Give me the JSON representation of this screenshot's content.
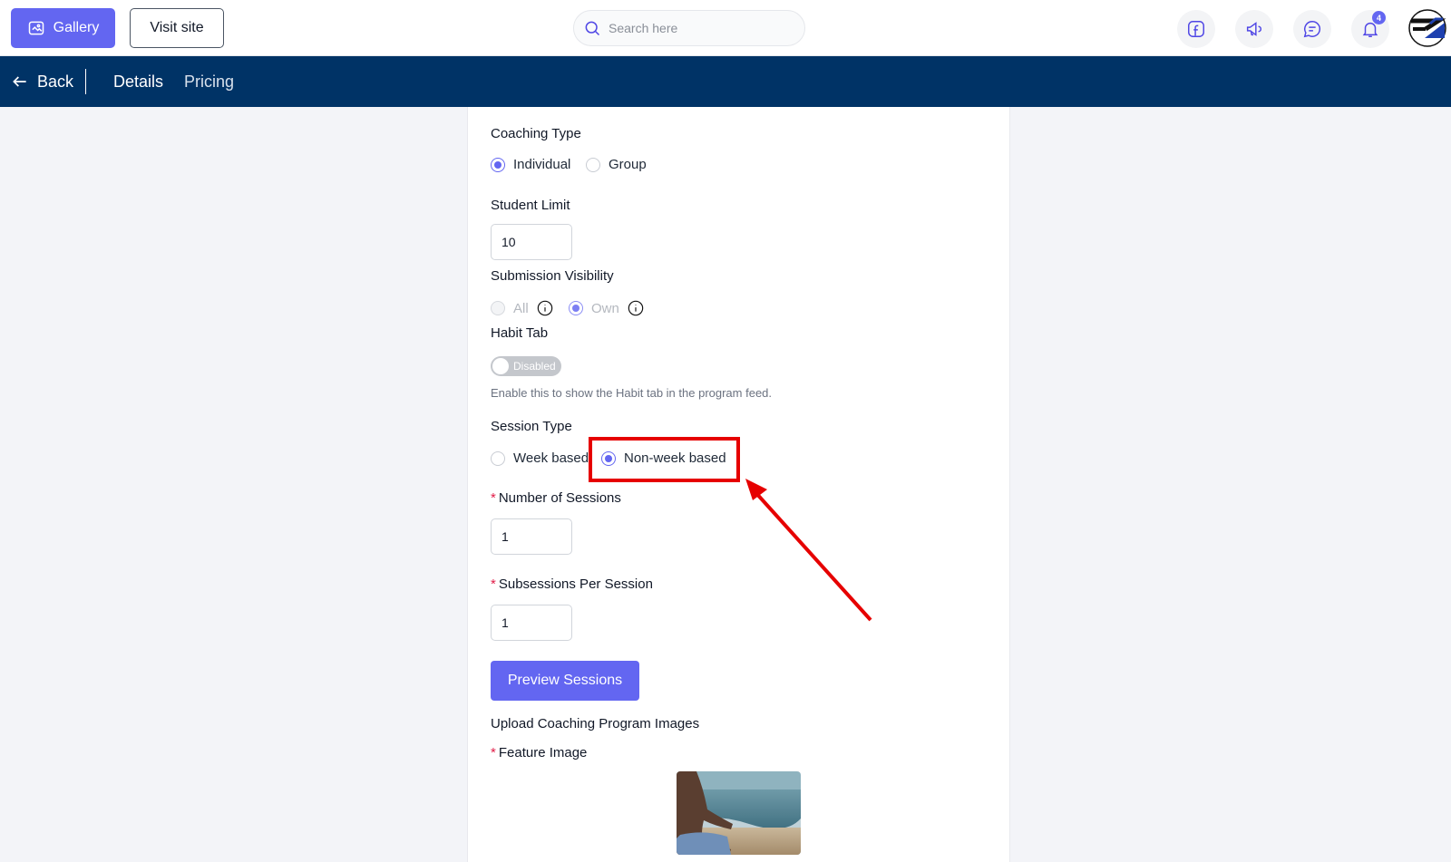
{
  "topbar": {
    "gallery_label": "Gallery",
    "visit_site_label": "Visit site",
    "search_placeholder": "Search here",
    "notification_count": "4",
    "icons": [
      "facebook-icon",
      "megaphone-icon",
      "chat-icon",
      "bell-icon"
    ]
  },
  "nav": {
    "back_label": "Back",
    "tabs": [
      {
        "label": "Details",
        "active": true
      },
      {
        "label": "Pricing",
        "active": false
      }
    ]
  },
  "form": {
    "coaching_type": {
      "label": "Coaching Type",
      "options": [
        {
          "label": "Individual",
          "checked": true
        },
        {
          "label": "Group",
          "checked": false
        }
      ]
    },
    "student_limit": {
      "label": "Student Limit",
      "value": "10"
    },
    "submission_visibility": {
      "label": "Submission Visibility",
      "options": [
        {
          "label": "All",
          "checked": false,
          "disabled": true
        },
        {
          "label": "Own",
          "checked": true,
          "disabled": true
        }
      ]
    },
    "habit_tab": {
      "label": "Habit Tab",
      "toggle_label": "Disabled",
      "enabled": false,
      "help": "Enable this to show the Habit tab in the program feed."
    },
    "session_type": {
      "label": "Session Type",
      "options": [
        {
          "label": "Week based",
          "checked": false
        },
        {
          "label": "Non-week based",
          "checked": true
        }
      ]
    },
    "number_of_sessions": {
      "label": "Number of Sessions",
      "required_mark": "*",
      "value": "1"
    },
    "subsessions_per_session": {
      "label": "Subsessions Per Session",
      "required_mark": "*",
      "value": "1"
    },
    "preview_button": "Preview Sessions",
    "upload_heading": "Upload Coaching Program Images",
    "feature_image": {
      "label": "Feature Image",
      "required_mark": "*"
    }
  },
  "colors": {
    "primary": "#6366f1",
    "navbar": "#003366",
    "annotation": "#e60000"
  }
}
